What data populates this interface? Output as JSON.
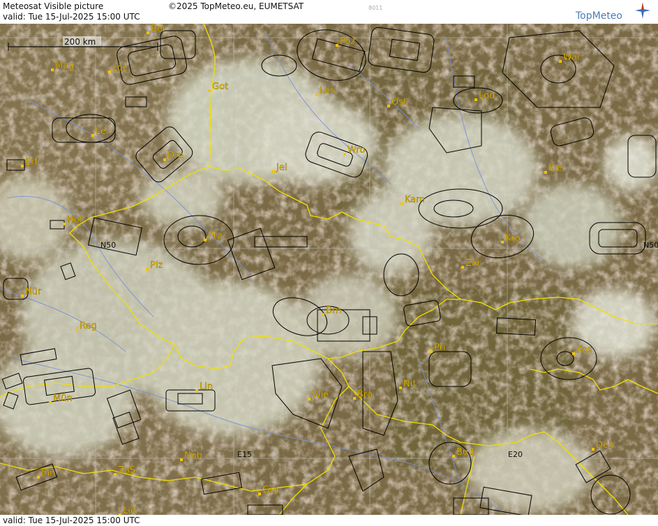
{
  "header": {
    "title": "Meteosat Visible picture",
    "valid": "valid:  Tue  15-Jul-2025  15:00 UTC",
    "copyright": "©2025 TopMeteo.eu, EUMETSAT",
    "code": "8011",
    "logo": "TopMeteo"
  },
  "footer": {
    "valid": "valid:  Tue  15-Jul-2025  15:00 UTC"
  },
  "map": {
    "scale_label": "200 km",
    "grid_labels": [
      "N50",
      "N50",
      "E15",
      "E20"
    ],
    "cities": [
      {
        "name": "Ber"
      },
      {
        "name": "Poz"
      },
      {
        "name": "War"
      },
      {
        "name": "Mag"
      },
      {
        "name": "Loc"
      },
      {
        "name": "Got"
      },
      {
        "name": "Les"
      },
      {
        "name": "Ost"
      },
      {
        "name": "Lod"
      },
      {
        "name": "Lei"
      },
      {
        "name": "Dre"
      },
      {
        "name": "Wro"
      },
      {
        "name": "Erf"
      },
      {
        "name": "Jel"
      },
      {
        "name": "Kie"
      },
      {
        "name": "Kam"
      },
      {
        "name": "Hof"
      },
      {
        "name": "Pra"
      },
      {
        "name": "Kra"
      },
      {
        "name": "Plz"
      },
      {
        "name": "Zar"
      },
      {
        "name": "Nür"
      },
      {
        "name": "Brn"
      },
      {
        "name": "Reg"
      },
      {
        "name": "Pri"
      },
      {
        "name": "Kos"
      },
      {
        "name": "Nit"
      },
      {
        "name": "Lin"
      },
      {
        "name": "Wie"
      },
      {
        "name": "Bra"
      },
      {
        "name": "Mün"
      },
      {
        "name": "Nöb"
      },
      {
        "name": "Bud"
      },
      {
        "name": "Deb"
      },
      {
        "name": "Inn"
      },
      {
        "name": "ZaS"
      },
      {
        "name": "Gra"
      },
      {
        "name": "Lie"
      }
    ]
  },
  "colors": {
    "border": "#f0e000",
    "river": "#7a8fd8",
    "city": "#f5c400",
    "contour": "#000000"
  }
}
